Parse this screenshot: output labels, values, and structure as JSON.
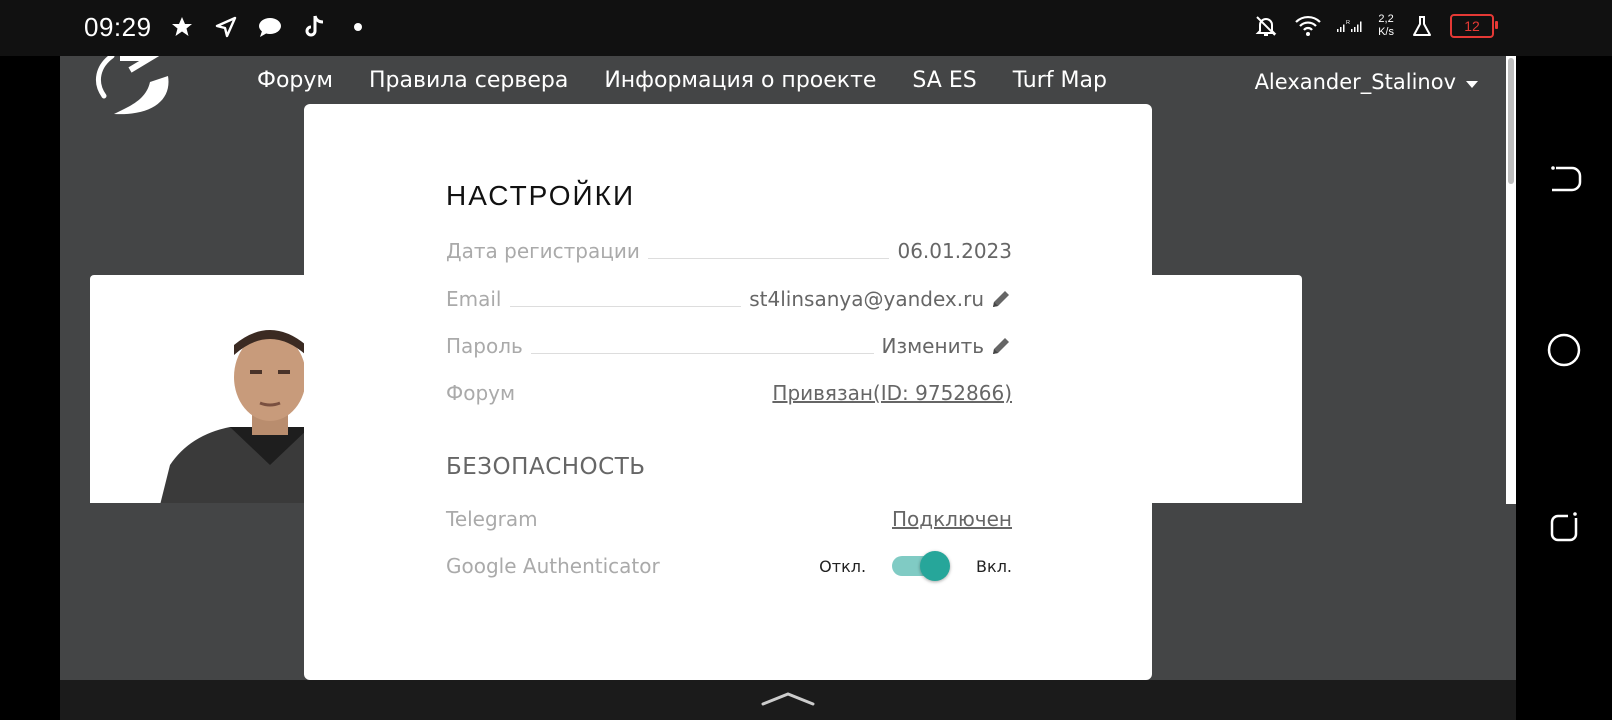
{
  "status_bar": {
    "time": "09:29",
    "left_icons": [
      "star-icon",
      "location-arrow-icon",
      "chat-bubble-icon",
      "tiktok-icon",
      "dot-icon"
    ],
    "net_speed_top": "2,2",
    "net_speed_bottom": "K/s",
    "battery": "12",
    "battery_color": "#e53935"
  },
  "header": {
    "nav": [
      "Форум",
      "Правила сервера",
      "Информация о проекте",
      "SA ES",
      "Turf Map"
    ],
    "user": "Alexander_Stalinov"
  },
  "modal": {
    "title": "НАСТРОЙКИ",
    "rows": [
      {
        "label": "Дата регистрации",
        "value": "06.01.2023"
      },
      {
        "label": "Email",
        "value": "st4linsanya@yandex.ru"
      },
      {
        "label": "Пароль",
        "value": "Изменить"
      },
      {
        "label": "Форум",
        "value": "Привязан(ID: 9752866)"
      }
    ],
    "security_title": "БЕЗОПАСНОСТЬ",
    "telegram": {
      "label": "Telegram",
      "value": "Подключен"
    },
    "google_auth": {
      "label": "Google Authenticator",
      "off": "Откл.",
      "on": "Вкл.",
      "enabled": true
    }
  },
  "colors": {
    "accent": "#26a69a",
    "page_bg": "#444546"
  }
}
